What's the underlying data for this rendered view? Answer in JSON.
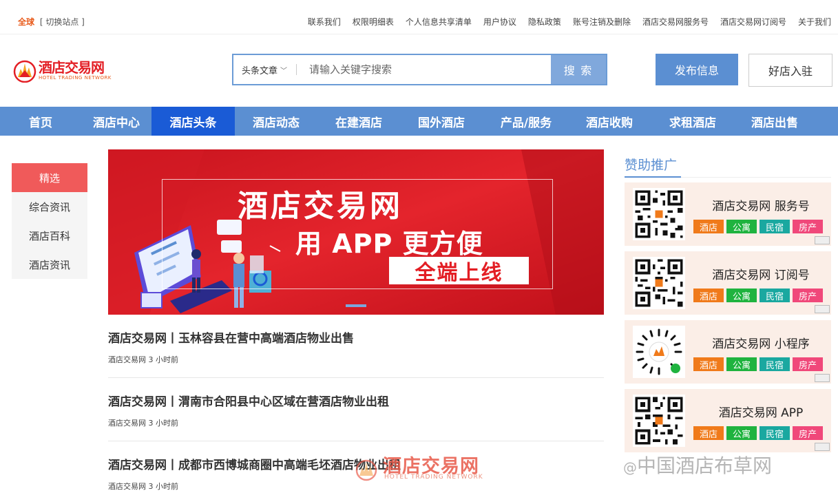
{
  "topbar": {
    "global": "全球",
    "switch": "[ 切换站点 ]",
    "links": [
      "联系我们",
      "权限明细表",
      "个人信息共享清单",
      "用户协议",
      "隐私政策",
      "账号注销及删除",
      "酒店交易网服务号",
      "酒店交易网订阅号",
      "关于我们"
    ]
  },
  "logo": {
    "cn": "酒店交易网",
    "en": "HOTEL TRADING NETWORK"
  },
  "search": {
    "category": "头条文章",
    "placeholder": "请输入关键字搜索",
    "button": "搜 索"
  },
  "header": {
    "publish": "发布信息",
    "join": "好店入驻"
  },
  "nav": [
    "首页",
    "酒店中心",
    "酒店头条",
    "酒店动态",
    "在建酒店",
    "国外酒店",
    "产品/服务",
    "酒店收购",
    "求租酒店",
    "酒店出售"
  ],
  "sidebar": [
    "精选",
    "综合资讯",
    "酒店百科",
    "酒店资讯"
  ],
  "banner": {
    "line1": "酒店交易网",
    "line2": "用 APP 更方便",
    "line3": "全端上线"
  },
  "articles": [
    {
      "title": "酒店交易网丨玉林容县在营中高端酒店物业出售",
      "meta": "酒店交易网 3 小时前"
    },
    {
      "title": "酒店交易网丨渭南市合阳县中心区域在营酒店物业出租",
      "meta": "酒店交易网 3 小时前"
    },
    {
      "title": "酒店交易网丨成都市西博城商圈中高端毛坯酒店物业出租",
      "meta": "酒店交易网 3 小时前"
    }
  ],
  "sponsor": {
    "title": "赞助推广",
    "cards": [
      {
        "name": "酒店交易网 服务号",
        "tags": [
          "酒店",
          "公寓",
          "民宿",
          "房产"
        ]
      },
      {
        "name": "酒店交易网 订阅号",
        "tags": [
          "酒店",
          "公寓",
          "民宿",
          "房产"
        ]
      },
      {
        "name": "酒店交易网 小程序",
        "tags": [
          "酒店",
          "公寓",
          "民宿",
          "房产"
        ]
      },
      {
        "name": "酒店交易网 APP",
        "tags": [
          "酒店",
          "公寓",
          "民宿",
          "房产"
        ]
      }
    ],
    "tag_colors": [
      "#f07a1a",
      "#1fb33f",
      "#1aa8a0",
      "#f0487a"
    ]
  },
  "watermark": {
    "logo_cn": "酒店交易网",
    "logo_en": "HOTEL TRADING NETWORK",
    "text": "中国酒店布草网",
    "prefix": "@"
  },
  "colors": {
    "accent": "#5b8fd2",
    "nav_active": "#1a5bd6",
    "brand_red": "#e31e24",
    "side_selected": "#f05a5a"
  }
}
